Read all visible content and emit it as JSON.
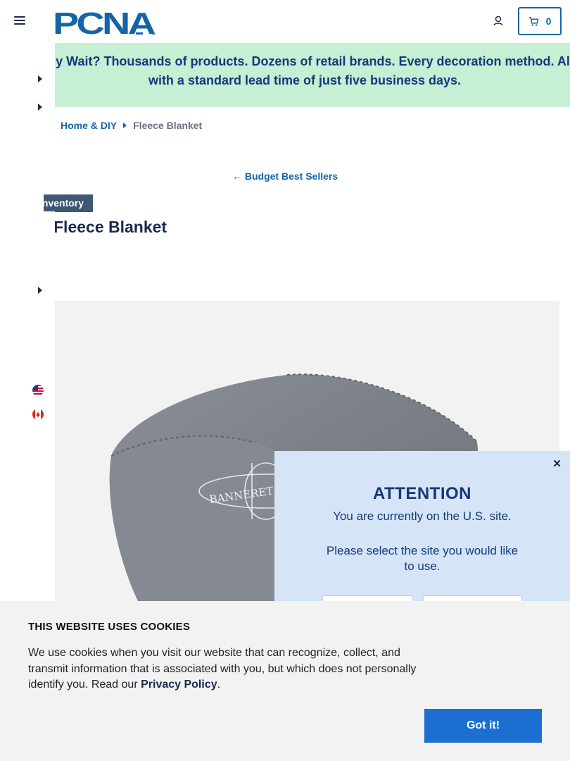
{
  "header": {
    "logo_text": "PCNA",
    "cart_count": "0"
  },
  "banner": {
    "text": "Why Wait? Thousands of products. Dozens of retail brands. Every decoration method. All with a standard lead time of just five business days."
  },
  "breadcrumb": {
    "parent": "Home & DIY",
    "current": "Fleece Blanket"
  },
  "back_link": "Budget Best Sellers",
  "product": {
    "badge": "Inventory",
    "title": "Fleece Blanket",
    "imprint_text": "BANNERET UNITED"
  },
  "cookie": {
    "title": "THIS WEBSITE USES COOKIES",
    "text_before": "We use cookies when you visit our website that can recognize, collect, and transmit information that is associated with you, but which does not personally identify you. Read our ",
    "link": "Privacy Policy",
    "text_after": ".",
    "button": "Got it!"
  },
  "modal": {
    "close": "×",
    "title": "ATTENTION",
    "line1": "You are currently on the U.S. site.",
    "line2": "Please select the site you would like to use."
  },
  "colors": {
    "brand_blue": "#1565a6",
    "navy": "#1b2a4e",
    "banner_bg": "#c6efd4",
    "modal_bg": "#d5e4f7",
    "button_blue": "#1c6fd1"
  }
}
